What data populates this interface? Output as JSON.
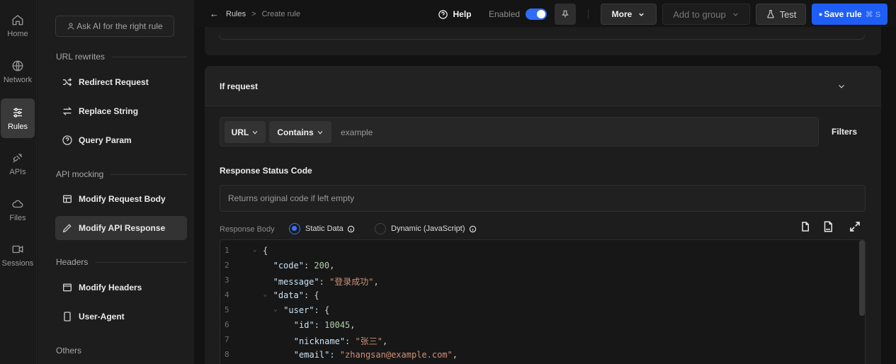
{
  "rail": [
    {
      "label": "Home",
      "icon": "home-icon"
    },
    {
      "label": "Network",
      "icon": "globe-icon"
    },
    {
      "label": "Rules",
      "icon": "sliders-icon"
    },
    {
      "label": "APIs",
      "icon": "plug-icon"
    },
    {
      "label": "Files",
      "icon": "cloud-icon"
    },
    {
      "label": "Sessions",
      "icon": "video-icon"
    }
  ],
  "sidebar": {
    "ask_ai": "Ask AI for the right rule",
    "sections": [
      "URL rewrites",
      "API mocking",
      "Headers",
      "Others"
    ],
    "items": [
      {
        "label": "Redirect Request",
        "icon": "shuffle-icon"
      },
      {
        "label": "Replace String",
        "icon": "swap-icon"
      },
      {
        "label": "Query Param",
        "icon": "question-circle-icon"
      },
      {
        "label": "Modify Request Body",
        "icon": "layout-icon"
      },
      {
        "label": "Modify API Response",
        "icon": "pencil-icon"
      },
      {
        "label": "Modify Headers",
        "icon": "browser-icon"
      },
      {
        "label": "User-Agent",
        "icon": "phone-icon"
      }
    ]
  },
  "topbar": {
    "breadcrumb_root": "Rules",
    "breadcrumb_sep": ">",
    "breadcrumb_current": "Create rule",
    "help": "Help",
    "enabled_label": "Enabled",
    "enabled": true,
    "more": "More",
    "add_to_group": "Add to group",
    "test": "Test",
    "save_rule": "Save rule",
    "save_shortcut": "⌘ S",
    "accent": "#1f5ef5"
  },
  "condition": {
    "title": "If request",
    "field": "URL",
    "operator": "Contains",
    "value": "example",
    "filters": "Filters"
  },
  "response": {
    "status_label": "Response Status Code",
    "status_placeholder": "Returns original code if left empty",
    "body_label": "Response Body",
    "option_static": "Static Data",
    "option_dynamic": "Dynamic (JavaScript)",
    "selected": "static"
  },
  "editor_lines": [
    {
      "n": "1",
      "fold": true,
      "indent": 0,
      "key": "",
      "value": "{",
      "comma": ""
    },
    {
      "n": "2",
      "fold": false,
      "indent": 1,
      "key": "\"code\"",
      "value": "200",
      "comma": ","
    },
    {
      "n": "3",
      "fold": false,
      "indent": 1,
      "key": "\"message\"",
      "value": "\"登录成功\"",
      "comma": ","
    },
    {
      "n": "4",
      "fold": true,
      "indent": 1,
      "key": "\"data\"",
      "value": "{",
      "comma": ""
    },
    {
      "n": "5",
      "fold": true,
      "indent": 2,
      "key": "\"user\"",
      "value": "{",
      "comma": ""
    },
    {
      "n": "6",
      "fold": false,
      "indent": 3,
      "key": "\"id\"",
      "value": "10045",
      "comma": ","
    },
    {
      "n": "7",
      "fold": false,
      "indent": 3,
      "key": "\"nickname\"",
      "value": "\"张三\"",
      "comma": ","
    },
    {
      "n": "8",
      "fold": false,
      "indent": 3,
      "key": "\"email\"",
      "value": "\"zhangsan@example.com\"",
      "comma": ","
    }
  ]
}
